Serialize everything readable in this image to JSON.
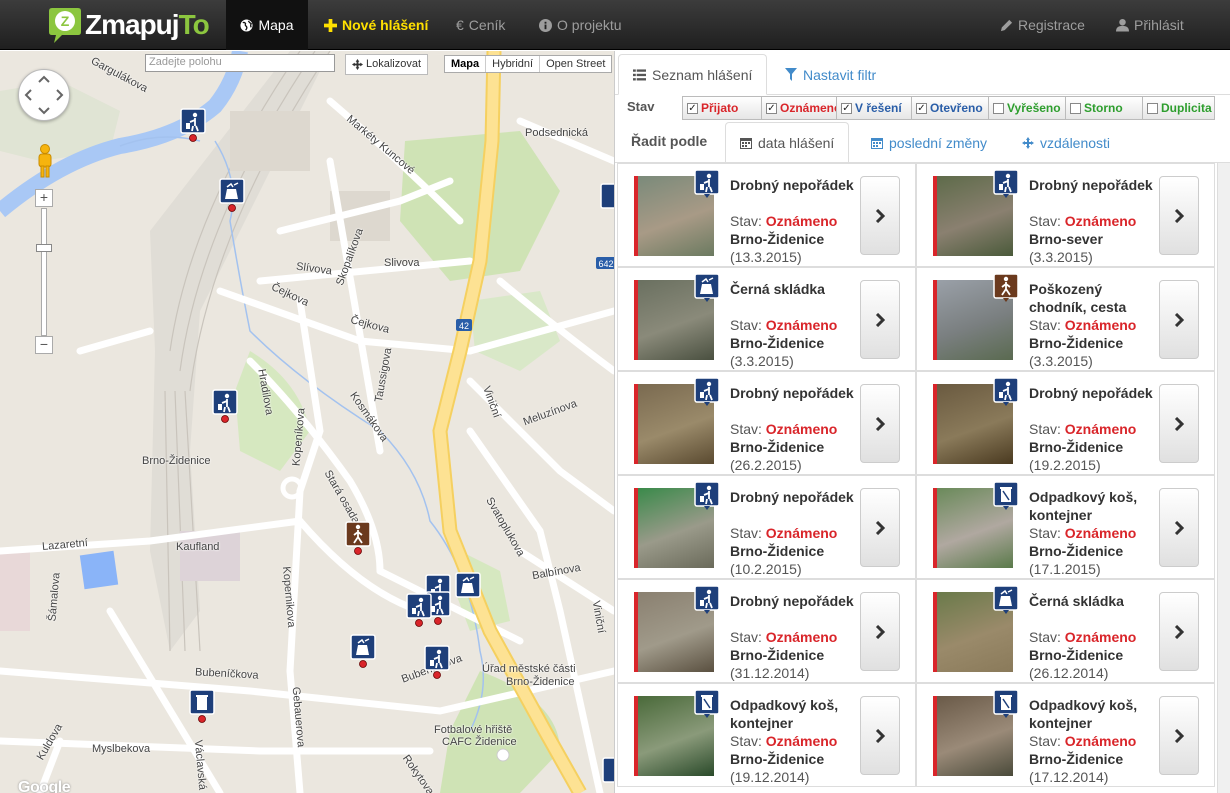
{
  "navbar": {
    "brand_main": "Zmapuj",
    "brand_accent": "To",
    "items": [
      {
        "label": "Mapa",
        "icon": "globe-icon"
      },
      {
        "label": "Nové hlášení",
        "icon": "plus-icon"
      },
      {
        "label": "Ceník",
        "icon": "euro-icon"
      },
      {
        "label": "O projektu",
        "icon": "info-icon"
      }
    ],
    "register": "Registrace",
    "login": "Přihlásit"
  },
  "map": {
    "search_placeholder": "Zadejte polohu",
    "localize": "Lokalizovat",
    "types": [
      "Mapa",
      "Hybridní",
      "Open Street"
    ],
    "labels": [
      "Gargulákova",
      "Podsednická",
      "Markéty Kuncové",
      "Skopalíkova",
      "Slívova",
      "Slivova",
      "Čejkova",
      "Čejkova",
      "Taussigova",
      "Hradilova",
      "Kopeníkova",
      "Kosmákova",
      "Viniční",
      "Meluzínova",
      "Brno-Židenice",
      "Stará osada",
      "Svatoplukova",
      "Lazaretní",
      "Kaufland",
      "Kopernikova",
      "Balbínova",
      "Šámalova",
      "Bubeníčkova",
      "Bubeníčkova",
      "Gebauerova",
      "Kuldova",
      "Myslbekova",
      "Václavská",
      "Úřad městské části",
      "Brno-Židenice",
      "Fotbalové hřiště",
      "CAFC Židenice",
      "Rokytova",
      "Viniční",
      "642",
      "42"
    ],
    "attribution": "Google"
  },
  "panel": {
    "tab_list": "Seznam hlášení",
    "tab_filter": "Nastavit filtr",
    "stav_label": "Stav",
    "statuses": [
      {
        "label": "Přijato",
        "checked": true,
        "color": "#d9252a"
      },
      {
        "label": "Oznámeno",
        "checked": true,
        "color": "#d9252a"
      },
      {
        "label": "V řešení",
        "checked": true,
        "color": "#2a5ea8"
      },
      {
        "label": "Otevřeno",
        "checked": true,
        "color": "#2a5ea8"
      },
      {
        "label": "Vyřešeno",
        "checked": false,
        "color": "#2e9e2e"
      },
      {
        "label": "Storno",
        "checked": false,
        "color": "#2e9e2e"
      },
      {
        "label": "Duplicita",
        "checked": false,
        "color": "#2e9e2e"
      }
    ],
    "sort_label": "Řadit podle",
    "sort_tabs": [
      "data hlášení",
      "poslední změny",
      "vzdálenosti"
    ],
    "stav_prefix": "Stav:",
    "reports": [
      {
        "title": "Drobný nepořádek",
        "status": "Oznámeno",
        "city": "Brno-Židenice",
        "date": "(13.3.2015)",
        "icon": "litter-icon"
      },
      {
        "title": "Drobný nepořádek",
        "status": "Oznámeno",
        "city": "Brno-sever",
        "date": "(3.3.2015)",
        "icon": "litter-icon"
      },
      {
        "title": "Černá skládka",
        "status": "Oznámeno",
        "city": "Brno-Židenice",
        "date": "(3.3.2015)",
        "icon": "dump-icon"
      },
      {
        "title": "Poškozený chodník, cesta",
        "status": "Oznámeno",
        "city": "Brno-Židenice",
        "date": "(3.3.2015)",
        "icon": "pedestrian-icon"
      },
      {
        "title": "Drobný nepořádek",
        "status": "Oznámeno",
        "city": "Brno-Židenice",
        "date": "(26.2.2015)",
        "icon": "litter-icon"
      },
      {
        "title": "Drobný nepořádek",
        "status": "Oznámeno",
        "city": "Brno-Židenice",
        "date": "(19.2.2015)",
        "icon": "litter-icon"
      },
      {
        "title": "Drobný nepořádek",
        "status": "Oznámeno",
        "city": "Brno-Židenice",
        "date": "(10.2.2015)",
        "icon": "litter-icon"
      },
      {
        "title": "Odpadkový koš, kontejner",
        "status": "Oznámeno",
        "city": "Brno-Židenice",
        "date": "(17.1.2015)",
        "icon": "bin-icon"
      },
      {
        "title": "Drobný nepořádek",
        "status": "Oznámeno",
        "city": "Brno-Židenice",
        "date": "(31.12.2014)",
        "icon": "litter-icon"
      },
      {
        "title": "Černá skládka",
        "status": "Oznámeno",
        "city": "Brno-Židenice",
        "date": "(26.12.2014)",
        "icon": "dump-icon"
      },
      {
        "title": "Odpadkový koš, kontejner",
        "status": "Oznámeno",
        "city": "Brno-Židenice",
        "date": "(19.12.2014)",
        "icon": "bin-icon"
      },
      {
        "title": "Odpadkový koš, kontejner",
        "status": "Oznámeno",
        "city": "Brno-Židenice",
        "date": "(17.12.2014)",
        "icon": "bin-icon"
      }
    ]
  }
}
